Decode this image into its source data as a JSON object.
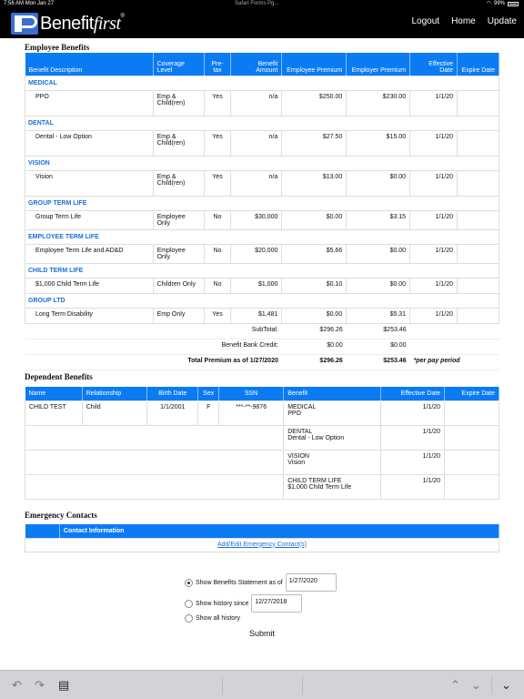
{
  "status": {
    "time": "7:56 AM",
    "date": "Mon Jan 27",
    "center": "Safari Forms Pg...",
    "battery": "99%"
  },
  "header": {
    "logo_main": "Benefit",
    "logo_italic": "first",
    "logo_tm": "®",
    "nav": {
      "logout": "Logout",
      "home": "Home",
      "update": "Update"
    }
  },
  "employee_benefits": {
    "title": "Employee Benefits",
    "headers": {
      "desc": "Benefit Description",
      "coverage": "Coverage Level",
      "pretax": "Pre-tax",
      "amount": "Benefit Amount",
      "emp_prem": "Employee Premium",
      "er_prem": "Employer Premium",
      "eff": "Effective Date",
      "exp": "Expire Date"
    },
    "categories": [
      {
        "name": "MEDICAL",
        "desc": "PPO",
        "coverage": "Emp & Child(ren)",
        "pretax": "Yes",
        "amount": "n/a",
        "emp": "$250.00",
        "er": "$230.00",
        "eff": "1/1/20",
        "exp": ""
      },
      {
        "name": "DENTAL",
        "desc": "Dental - Low Option",
        "coverage": "Emp & Child(ren)",
        "pretax": "Yes",
        "amount": "n/a",
        "emp": "$27.50",
        "er": "$15.00",
        "eff": "1/1/20",
        "exp": ""
      },
      {
        "name": "VISION",
        "desc": "Vision",
        "coverage": "Emp & Child(ren)",
        "pretax": "Yes",
        "amount": "n/a",
        "emp": "$13.00",
        "er": "$0.00",
        "eff": "1/1/20",
        "exp": ""
      },
      {
        "name": "GROUP TERM LIFE",
        "desc": "Group Term Life",
        "coverage": "Employee Only",
        "pretax": "No",
        "amount": "$30,000",
        "emp": "$0.00",
        "er": "$3.15",
        "eff": "1/1/20",
        "exp": ""
      },
      {
        "name": "EMPLOYEE TERM LIFE",
        "desc": "Employee Term Life and AD&D",
        "coverage": "Employee Only",
        "pretax": "No",
        "amount": "$20,000",
        "emp": "$5.66",
        "er": "$0.00",
        "eff": "1/1/20",
        "exp": ""
      },
      {
        "name": "CHILD TERM LIFE",
        "desc": "$1,000 Child Term Life",
        "coverage": "Children Only",
        "pretax": "No",
        "amount": "$1,000",
        "emp": "$0.10",
        "er": "$0.00",
        "eff": "1/1/20",
        "exp": ""
      },
      {
        "name": "GROUP LTD",
        "desc": "Long Term Disability",
        "coverage": "Emp Only",
        "pretax": "Yes",
        "amount": "$1,481",
        "emp": "$0.00",
        "er": "$5.31",
        "eff": "1/1/20",
        "exp": ""
      }
    ],
    "subtotal": {
      "label": "SubTotal:",
      "emp": "$296.26",
      "er": "$253.46"
    },
    "bank_credit": {
      "label": "Benefit Bank Credit:",
      "emp": "$0.00",
      "er": "$0.00"
    },
    "total": {
      "label": "Total Premium as of 1/27/2020",
      "emp": "$296.26",
      "er": "$253.46",
      "note": "*per pay period"
    }
  },
  "dependent_benefits": {
    "title": "Dependent Benefits",
    "headers": {
      "name": "Name",
      "relationship": "Relationship",
      "dob": "Birth Date",
      "sex": "Sex",
      "ssn": "SSN",
      "benefit": "Benefit",
      "eff": "Effective Date",
      "exp": "Expire Date"
    },
    "dependent": {
      "name": "CHILD TEST",
      "relationship": "Child",
      "dob": "1/1/2001",
      "sex": "F",
      "ssn": "***-**-9876"
    },
    "benefits": [
      {
        "cat": "MEDICAL",
        "plan": "PPO",
        "eff": "1/1/20"
      },
      {
        "cat": "DENTAL",
        "plan": "Dental - Low Option",
        "eff": "1/1/20"
      },
      {
        "cat": "VISION",
        "plan": "Vision",
        "eff": "1/1/20"
      },
      {
        "cat": "CHILD TERM LIFE",
        "plan": "$1,000 Child Term Life",
        "eff": "1/1/20"
      }
    ]
  },
  "emergency_contacts": {
    "title": "Emergency Contacts",
    "header": "Contact Information",
    "link": "Add/Edit Emergency Contact(s)"
  },
  "options": {
    "statement_label": "Show Benefits Statement as of",
    "statement_date": "1/27/2020",
    "history_label": "Show history since",
    "history_date": "12/27/2018",
    "all_label": "Show all history",
    "submit": "Submit"
  },
  "toolbar": {
    "undo": "↶",
    "redo": "↷",
    "paste": "▤",
    "up": "⌃",
    "down": "⌄"
  }
}
